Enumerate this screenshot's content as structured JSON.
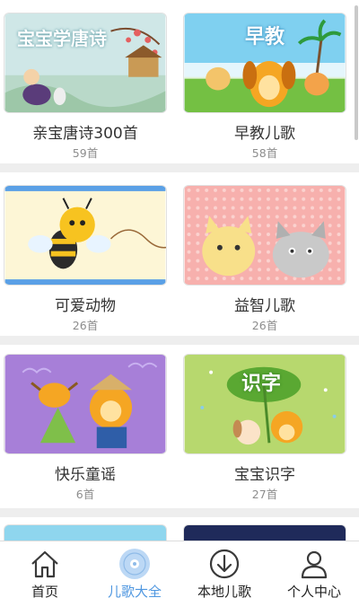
{
  "grid": [
    {
      "title": "亲宝唐诗300首",
      "count": "59首",
      "banner": "宝宝学唐诗",
      "accent": "#c8e4e6"
    },
    {
      "title": "早教儿歌",
      "count": "58首",
      "banner": "早教",
      "accent": "#7fd0f0"
    },
    {
      "title": "可爱动物",
      "count": "26首",
      "banner": "",
      "accent": "#fdf6d6"
    },
    {
      "title": "益智儿歌",
      "count": "26首",
      "banner": "",
      "accent": "#f7b0ad"
    },
    {
      "title": "快乐童谣",
      "count": "6首",
      "banner": "",
      "accent": "#a77fd8"
    },
    {
      "title": "宝宝识字",
      "count": "27首",
      "banner": "识字",
      "accent": "#b7d86e"
    }
  ],
  "tabs": [
    {
      "label": "首页",
      "icon": "home-icon",
      "active": false
    },
    {
      "label": "儿歌大全",
      "icon": "disc-icon",
      "active": true
    },
    {
      "label": "本地儿歌",
      "icon": "download-icon",
      "active": false
    },
    {
      "label": "个人中心",
      "icon": "person-icon",
      "active": false
    }
  ],
  "colors": {
    "active_tab": "#4f97e0",
    "title": "#333333",
    "count": "#8d8d8d"
  }
}
